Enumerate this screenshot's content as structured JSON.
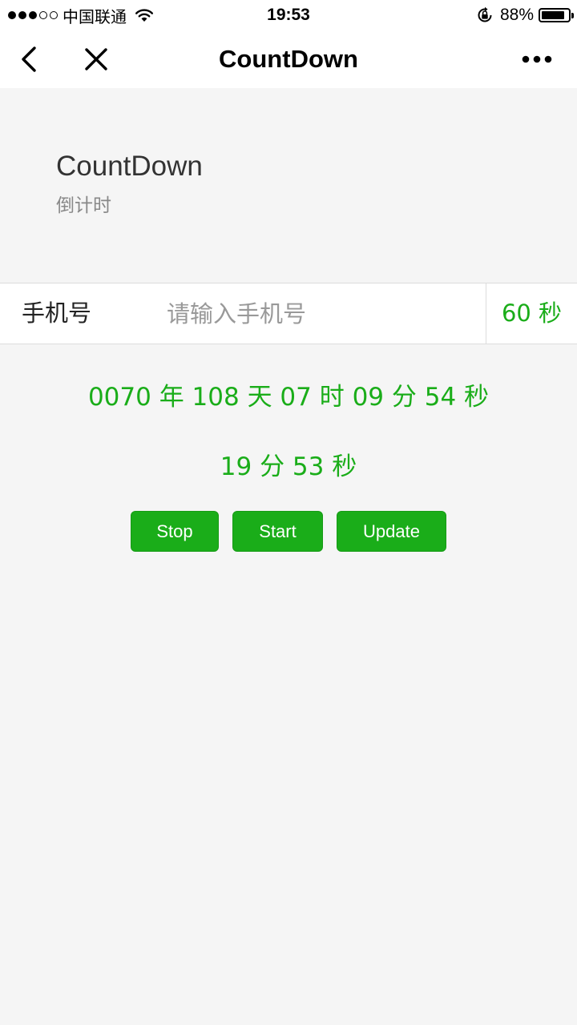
{
  "status_bar": {
    "signal_dots": [
      true,
      true,
      true,
      false,
      false
    ],
    "carrier": "中国联通",
    "time": "19:53",
    "battery_percent": "88%",
    "battery_level": 0.88
  },
  "nav": {
    "title": "CountDown",
    "back_icon": "chevron-left-icon",
    "close_icon": "close-icon",
    "more_icon": "more-dots-icon"
  },
  "header": {
    "title": "CountDown",
    "description": "倒计时"
  },
  "phone_cell": {
    "label": "手机号",
    "value": "",
    "placeholder": "请输入手机号",
    "button_label": "60 秒"
  },
  "countdowns": {
    "long": "0070 年 108 天 07 时 09 分 54 秒",
    "short": "19 分 53 秒"
  },
  "buttons": {
    "stop": "Stop",
    "start": "Start",
    "update": "Update"
  },
  "colors": {
    "accent": "#1aad19",
    "background": "#f5f5f5"
  }
}
